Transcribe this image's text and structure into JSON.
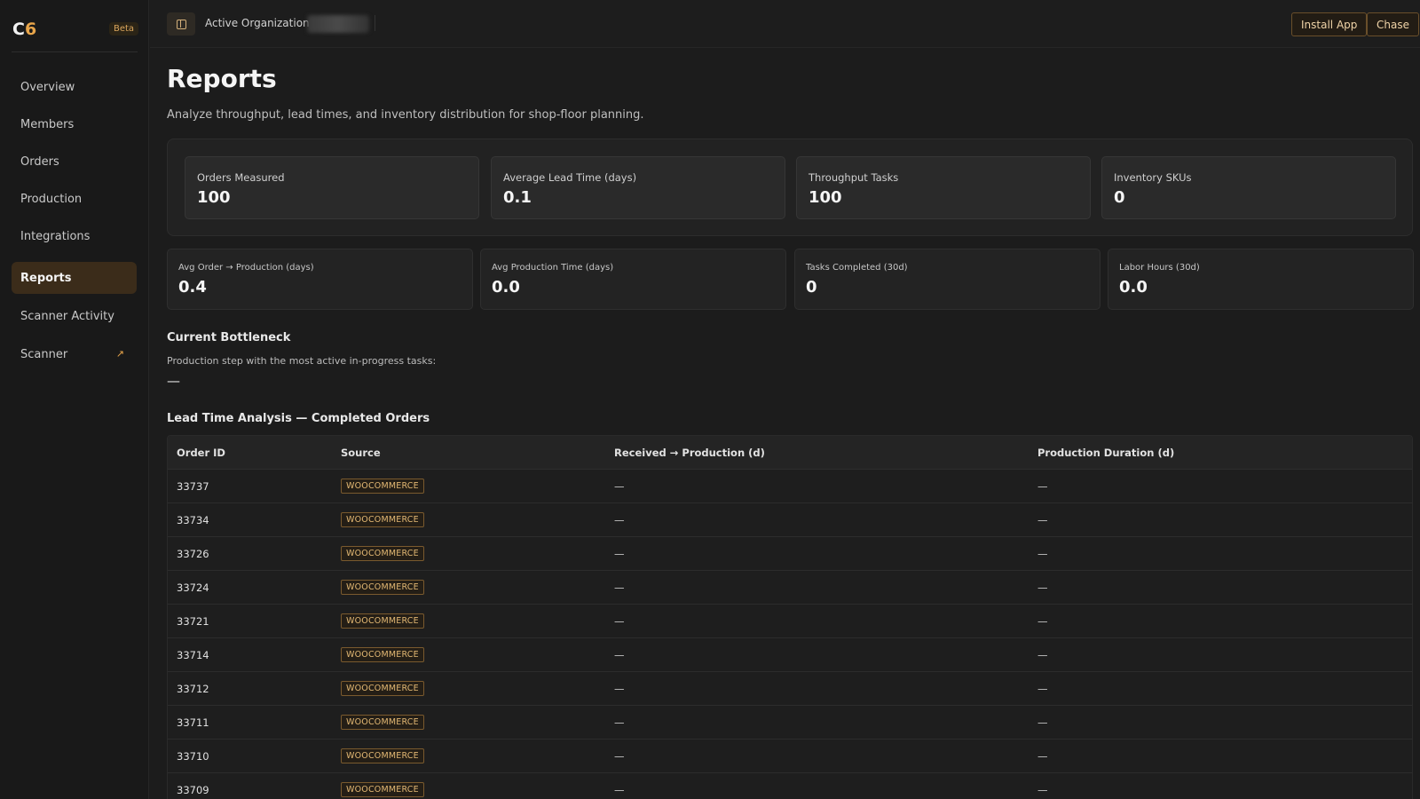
{
  "brand": {
    "logo": "C6",
    "badge": "Beta"
  },
  "sidebar": {
    "items": [
      {
        "label": "Overview",
        "active": false
      },
      {
        "label": "Members",
        "active": false
      },
      {
        "label": "Orders",
        "active": false
      },
      {
        "label": "Production",
        "active": false
      },
      {
        "label": "Integrations",
        "active": false
      },
      {
        "label": "Reports",
        "active": true
      },
      {
        "label": "Scanner Activity",
        "active": false
      },
      {
        "label": "Scanner",
        "active": false,
        "external": true
      }
    ]
  },
  "topbar": {
    "org_label": "Active Organization",
    "org_value": "",
    "install_label": "Install App",
    "user_label": "Chase"
  },
  "page": {
    "title": "Reports",
    "subtitle": "Analyze throughput, lead times, and inventory distribution for shop-floor planning."
  },
  "kpis_primary": [
    {
      "label": "Orders Measured",
      "value": "100"
    },
    {
      "label": "Average Lead Time (days)",
      "value": "0.1"
    },
    {
      "label": "Throughput Tasks",
      "value": "100"
    },
    {
      "label": "Inventory SKUs",
      "value": "0"
    }
  ],
  "kpis_secondary": [
    {
      "label": "Avg Order → Production (days)",
      "value": "0.4"
    },
    {
      "label": "Avg Production Time (days)",
      "value": "0.0"
    },
    {
      "label": "Tasks Completed (30d)",
      "value": "0"
    },
    {
      "label": "Labor Hours (30d)",
      "value": "0.0"
    }
  ],
  "bottleneck": {
    "title": "Current Bottleneck",
    "description": "Production step with the most active in-progress tasks:",
    "value": "—"
  },
  "lead_time": {
    "title": "Lead Time Analysis — Completed Orders",
    "columns": [
      "Order ID",
      "Source",
      "Received → Production (d)",
      "Production Duration (d)"
    ],
    "rows": [
      {
        "order_id": "33737",
        "source": "WOOCOMMERCE",
        "received_to_production": "—",
        "production_duration": "—"
      },
      {
        "order_id": "33734",
        "source": "WOOCOMMERCE",
        "received_to_production": "—",
        "production_duration": "—"
      },
      {
        "order_id": "33726",
        "source": "WOOCOMMERCE",
        "received_to_production": "—",
        "production_duration": "—"
      },
      {
        "order_id": "33724",
        "source": "WOOCOMMERCE",
        "received_to_production": "—",
        "production_duration": "—"
      },
      {
        "order_id": "33721",
        "source": "WOOCOMMERCE",
        "received_to_production": "—",
        "production_duration": "—"
      },
      {
        "order_id": "33714",
        "source": "WOOCOMMERCE",
        "received_to_production": "—",
        "production_duration": "—"
      },
      {
        "order_id": "33712",
        "source": "WOOCOMMERCE",
        "received_to_production": "—",
        "production_duration": "—"
      },
      {
        "order_id": "33711",
        "source": "WOOCOMMERCE",
        "received_to_production": "—",
        "production_duration": "—"
      },
      {
        "order_id": "33710",
        "source": "WOOCOMMERCE",
        "received_to_production": "—",
        "production_duration": "—"
      },
      {
        "order_id": "33709",
        "source": "WOOCOMMERCE",
        "received_to_production": "—",
        "production_duration": "—"
      }
    ]
  },
  "colors": {
    "accent": "#e8a54a",
    "active_nav_bg": "#3b2c1a",
    "background": "#1c1c1c"
  },
  "icons": {
    "panel_toggle": "sidebar-toggle-icon",
    "external_link": "arrow-up-right-icon"
  }
}
